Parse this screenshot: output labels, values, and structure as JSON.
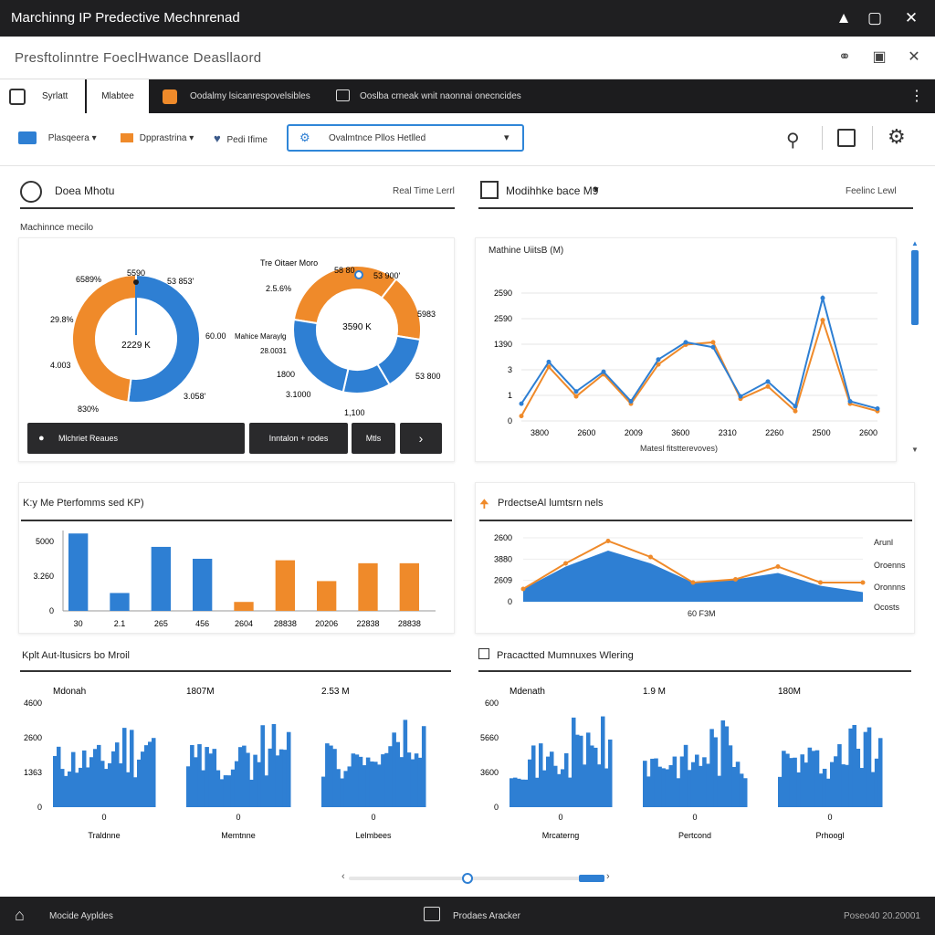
{
  "window": {
    "title": "Marchinng IP Predective Mechnrenad"
  },
  "subheader": {
    "title": "Presftolinntre FoeclHwance Deasllaord"
  },
  "tabs": [
    {
      "label": "Syrlatt"
    },
    {
      "label": "Mlabtee"
    },
    {
      "label": "Oodalmy lsicanrespovelsibles"
    },
    {
      "label": "Ooslba crneak wnit naonnai onecncides"
    }
  ],
  "toolbar": {
    "item1": "Plasqeera",
    "item2": "Dpprastrina",
    "item3": "Pedi Ifime",
    "combo_value": "Ovalmtnce Pllos Hetlled"
  },
  "sections": {
    "left_title": "Doea Mhotu",
    "left_right": "Real Time Lerrl",
    "right_title": "Modihhke bace M9",
    "right_right": "Feelinc Lewl",
    "machine_metric": "Machinnce mecilo"
  },
  "donut1": {
    "center": "2229 K",
    "labels": [
      "6589%",
      "5590",
      "53 853'",
      "29.8%",
      "60.00",
      "4.003",
      "3.058'",
      "830%"
    ]
  },
  "donut2": {
    "title": "Tre Oitaer Moro",
    "center": "3590 K",
    "labels": [
      "58 80",
      "53 900'",
      "2.5.6%",
      "5983",
      "Mahice Maraylg",
      "28.0031",
      "1800",
      "3.1000",
      "53 800",
      "1,100"
    ]
  },
  "buttons": {
    "b1": "Mlchriet Reaues",
    "b2": "Inntalon + rodes",
    "b3": "Mtls",
    "b4": "›"
  },
  "line_panel": {
    "title": "Mathine UiitsB (M)",
    "xlabel": "Matesl fitstterevoves)"
  },
  "kpi_panel": {
    "title": "K:y Me Pterfomms sed KP)"
  },
  "pred_panel": {
    "title": "PrdectseAl lumtsrn nels",
    "xlabel": "60 F3M",
    "legend": [
      "Arunl",
      "Oroenns",
      "Oronnns",
      "Ocosts"
    ]
  },
  "bottom_left": {
    "title": "Kplt Aut-ltusicrs bo Mroil",
    "values": [
      "Mdonah",
      "1807M",
      "2.53 M"
    ],
    "xlabels": [
      "Traldnne",
      "Memtnne",
      "Lelmbees"
    ],
    "yticks": [
      "4600",
      "2600",
      "1363",
      "0"
    ],
    "zero": "0"
  },
  "bottom_right": {
    "title": "Pracactted Mumnuxes Wlering",
    "values": [
      "Mdenath",
      "1.9 M",
      "180M"
    ],
    "xlabels": [
      "Mrcaterng",
      "Pertcond",
      "Prhoogl"
    ],
    "yticks": [
      "600",
      "5660",
      "3600",
      "0"
    ],
    "zero": "0"
  },
  "footer": {
    "left": "Mocide Aypldes",
    "center": "Prodaes Aracker",
    "right": "Poseo40 20.20001"
  },
  "colors": {
    "blue": "#2e7fd3",
    "orange": "#ef8a2a",
    "dark": "#1f1f21"
  },
  "chart_data": [
    {
      "type": "pie",
      "title": "",
      "values": [
        52,
        48
      ],
      "colors": [
        "#2e7fd3",
        "#ef8a2a"
      ]
    },
    {
      "type": "pie",
      "title": "Tre Oitaer Moro",
      "values": [
        33,
        17,
        14,
        12,
        24
      ],
      "colors": [
        "#ef8a2a",
        "#ef8a2a",
        "#2e7fd3",
        "#2e7fd3",
        "#2e7fd3"
      ]
    },
    {
      "type": "line",
      "title": "Mathine UiitsB (M)",
      "xlabel": "Matesl fitstterevoves)",
      "yticks": [
        "2590",
        "2590",
        "1390",
        "3",
        "1",
        "0"
      ],
      "xticks": [
        "3800",
        "2600",
        "2009",
        "3600",
        "2310",
        "2260",
        "2500",
        "2600"
      ],
      "series": [
        {
          "values": [
            0.7,
            2.4,
            1.2,
            2.0,
            0.8,
            2.5,
            3.2,
            3.0,
            1.0,
            1.6,
            0.6,
            5.0,
            0.8,
            0.5
          ],
          "color": "#2e7fd3"
        },
        {
          "values": [
            0.2,
            2.2,
            1.0,
            1.9,
            0.7,
            2.3,
            3.1,
            3.2,
            0.9,
            1.4,
            0.4,
            4.1,
            0.7,
            0.4
          ],
          "color": "#ef8a2a"
        }
      ]
    },
    {
      "type": "bar",
      "title": "K:y Me Pterfomms sed KP)",
      "categories": [
        "30",
        "2.1",
        "265",
        "456",
        "2604",
        "28838",
        "20206",
        "22838",
        "28838"
      ],
      "values": [
        5200,
        1200,
        4300,
        3500,
        600,
        3400,
        2000,
        3200,
        3200
      ],
      "yticks": [
        "5000",
        "3.260",
        "0"
      ],
      "colors": [
        "#2e7fd3",
        "#2e7fd3",
        "#2e7fd3",
        "#2e7fd3",
        "#ef8a2a",
        "#ef8a2a",
        "#ef8a2a",
        "#ef8a2a",
        "#ef8a2a"
      ]
    },
    {
      "type": "area",
      "title": "PrdectseAl lumtsrn nels",
      "yticks": [
        "2600",
        "3880",
        "2609",
        "0"
      ],
      "series": [
        {
          "values": [
            0.4,
            1.1,
            1.6,
            1.2,
            0.6,
            0.7,
            0.9,
            0.5,
            0.3
          ],
          "color": "#2e7fd3"
        },
        {
          "values": [
            0.4,
            1.2,
            1.9,
            1.4,
            0.6,
            0.7,
            1.1,
            0.6,
            0.6
          ],
          "color": "#ef8a2a"
        }
      ]
    }
  ]
}
